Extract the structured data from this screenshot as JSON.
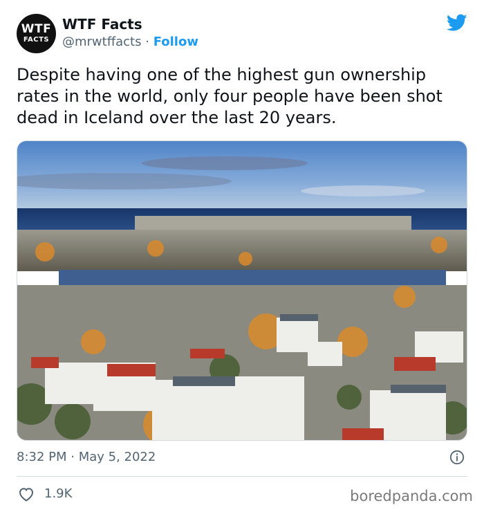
{
  "account": {
    "avatar_line1": "WTF",
    "avatar_line2": "FACTS",
    "name": "WTF Facts",
    "handle": "@mrwtffacts",
    "separator": "·",
    "follow_label": "Follow"
  },
  "tweet": {
    "text": "Despite having one of the highest gun ownership rates in the world, only four people have been shot dead in Iceland over the last 20 years.",
    "timestamp": "8:32 PM · May 5, 2022",
    "like_count": "1.9K"
  },
  "footer": {
    "watermark": "boredpanda.com"
  },
  "icons": {
    "brand": "twitter-bird-icon",
    "info": "info-icon",
    "like": "heart-icon"
  },
  "colors": {
    "accent": "#1d9bf0",
    "muted": "#536471",
    "text": "#0f1419",
    "divider": "#cfd9de"
  }
}
